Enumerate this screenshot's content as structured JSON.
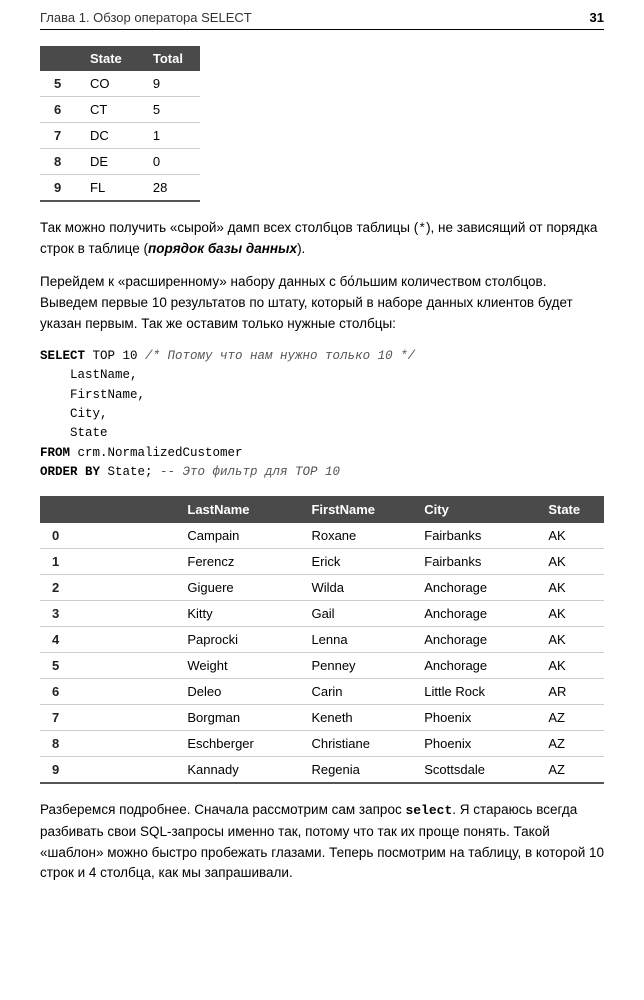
{
  "header": {
    "chapter": "Глава 1. Обзор оператора SELECT",
    "page_number": "31"
  },
  "small_table": {
    "columns": [
      "",
      "State",
      "Total"
    ],
    "rows": [
      {
        "num": "5",
        "state": "CO",
        "total": "9"
      },
      {
        "num": "6",
        "state": "CT",
        "total": "5"
      },
      {
        "num": "7",
        "state": "DC",
        "total": "1"
      },
      {
        "num": "8",
        "state": "DE",
        "total": "0"
      },
      {
        "num": "9",
        "state": "FL",
        "total": "28"
      }
    ]
  },
  "paragraphs": {
    "p1": "Так можно получить «сырой» дамп всех столбцов таблицы (*), не зависящий от порядка строк в таблице (",
    "p1_italic": "порядок базы данных",
    "p1_end": ").",
    "p2": "Перейдем к «расширенному» набору данных с бо́льшим количеством столбцов. Выведем первые 10 результатов по штату, который в наборе данных клиентов будет указан первым. Так же оставим только нужные столбцы:"
  },
  "code_block": {
    "line1": "SELECT TOP 10 /* Потому что нам нужно только 10 */",
    "line2": "    LastName,",
    "line3": "    FirstName,",
    "line4": "    City,",
    "line5": "    State",
    "line6": "FROM crm.NormalizedCustomer",
    "line7": "ORDER BY State; -- Это фильтр для TOP 10"
  },
  "large_table": {
    "columns": [
      "",
      "LastName",
      "FirstName",
      "City",
      "State"
    ],
    "rows": [
      {
        "num": "0",
        "last": "Campain",
        "first": "Roxane",
        "city": "Fairbanks",
        "state": "AK"
      },
      {
        "num": "1",
        "last": "Ferencz",
        "first": "Erick",
        "city": "Fairbanks",
        "state": "AK"
      },
      {
        "num": "2",
        "last": "Giguere",
        "first": "Wilda",
        "city": "Anchorage",
        "state": "AK"
      },
      {
        "num": "3",
        "last": "Kitty",
        "first": "Gail",
        "city": "Anchorage",
        "state": "AK"
      },
      {
        "num": "4",
        "last": "Paprocki",
        "first": "Lenna",
        "city": "Anchorage",
        "state": "AK"
      },
      {
        "num": "5",
        "last": "Weight",
        "first": "Penney",
        "city": "Anchorage",
        "state": "AK"
      },
      {
        "num": "6",
        "last": "Deleo",
        "first": "Carin",
        "city": "Little Rock",
        "state": "AR"
      },
      {
        "num": "7",
        "last": "Borgman",
        "first": "Keneth",
        "city": "Phoenix",
        "state": "AZ"
      },
      {
        "num": "8",
        "last": "Eschberger",
        "first": "Christiane",
        "city": "Phoenix",
        "state": "AZ"
      },
      {
        "num": "9",
        "last": "Kannady",
        "first": "Regenia",
        "city": "Scottsdale",
        "state": "AZ"
      }
    ]
  },
  "paragraph_end": "Разберемся подробнее. Сначала рассмотрим сам запрос ",
  "paragraph_end_code": "select",
  "paragraph_end2": ". Я стараюсь всегда разбивать свои SQL-запросы именно так, потому что так их проще понять. Такой «шаблон» можно быстро пробежать глазами. Теперь посмотрим на таблицу, в которой 10 строк и 4 столбца, как мы запрашивали."
}
